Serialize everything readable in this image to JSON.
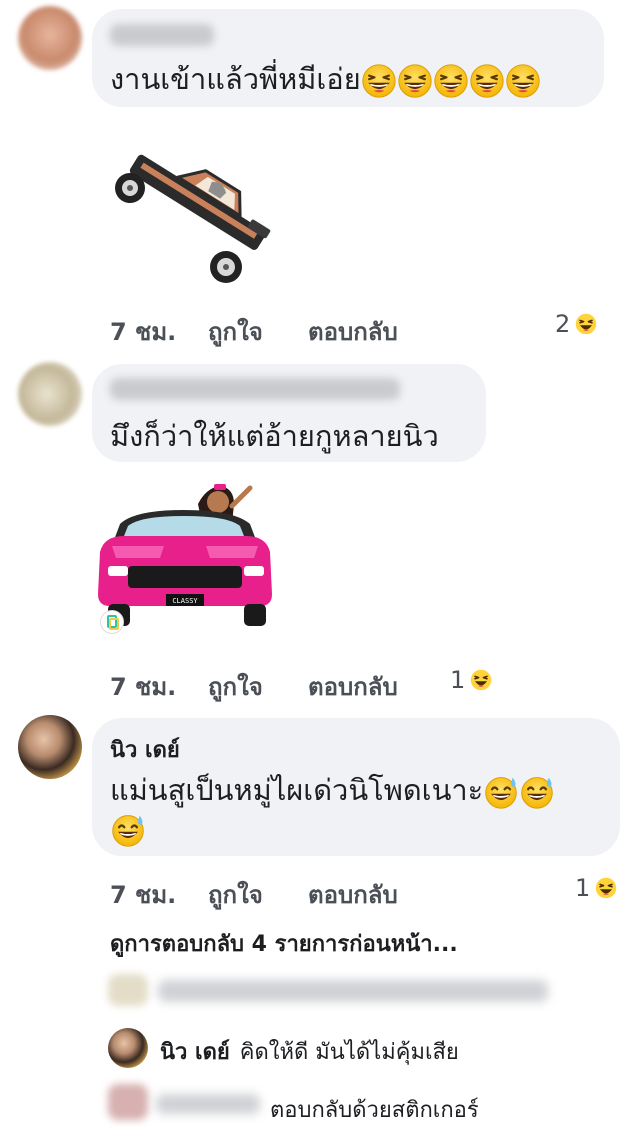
{
  "comments": [
    {
      "text": "งานเข้าแล้วพี่หมีเอ่ย",
      "time": "7 ชม.",
      "like_label": "ถูกใจ",
      "reply_label": "ตอบกลับ",
      "reaction_count": "2",
      "sticker": "lowrider-car-sticker"
    },
    {
      "text": "มึงก็ว่าให้แต่อ้ายกูหลายนิว",
      "time": "7 ชม.",
      "like_label": "ถูกใจ",
      "reply_label": "ตอบกลับ",
      "reaction_count": "1",
      "sticker": "pink-convertible-sticker",
      "plate": "CLASSY"
    },
    {
      "author": "นิว เดย์",
      "text_line1": "แม่นสูเป็นหมู่ไผเด่วนิโพดเนาะ",
      "time": "7 ชม.",
      "like_label": "ถูกใจ",
      "reply_label": "ตอบกลับ",
      "reaction_count": "1"
    }
  ],
  "view_previous": "ดูการตอบกลับ 4 รายการก่อนหน้า...",
  "replies": [
    {
      "author": "นิว เดย์",
      "text": "คิดให้ดี มันได้ไม่คุ้มเสีย"
    },
    {
      "text": "ตอบกลับด้วยสติกเกอร์"
    }
  ],
  "colors": {
    "bubble": "#f0f2f5",
    "meta_text": "#4b4f56",
    "sticker_pink": "#e8208c"
  }
}
